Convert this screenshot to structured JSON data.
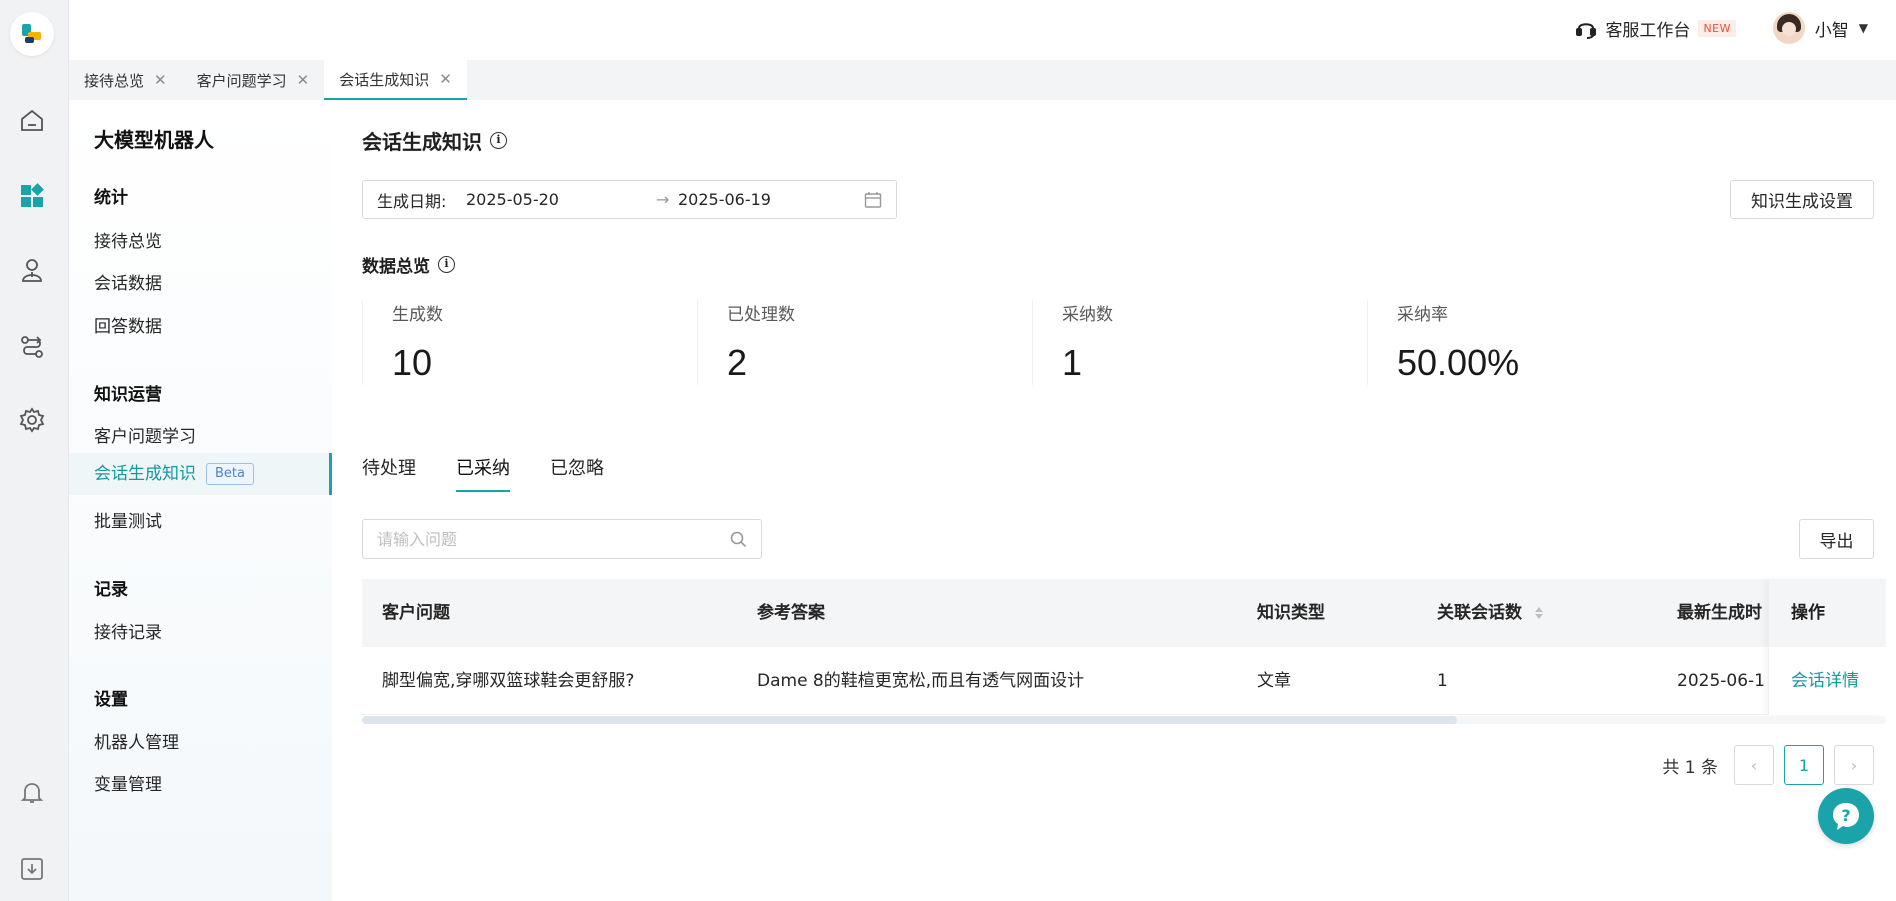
{
  "topbar": {
    "cs_label": "客服工作台",
    "cs_badge": "NEW",
    "user_name": "小智"
  },
  "tabs": [
    {
      "label": "接待总览"
    },
    {
      "label": "客户问题学习"
    },
    {
      "label": "会话生成知识"
    }
  ],
  "sidebar": {
    "title": "大模型机器人",
    "groups": [
      {
        "label": "统计",
        "items": [
          "接待总览",
          "会话数据",
          "回答数据"
        ]
      },
      {
        "label": "知识运营",
        "items": [
          "客户问题学习",
          "会话生成知识",
          "批量测试"
        ]
      },
      {
        "label": "记录",
        "items": [
          "接待记录"
        ]
      },
      {
        "label": "设置",
        "items": [
          "机器人管理",
          "变量管理"
        ]
      }
    ],
    "beta_badge": "Beta"
  },
  "main": {
    "title": "会话生成知识",
    "date": {
      "label": "生成日期:",
      "start": "2025-05-20",
      "arrow": "→",
      "end": "2025-06-19"
    },
    "settings_button": "知识生成设置",
    "overview_title": "数据总览",
    "stats": [
      {
        "label": "生成数",
        "value": "10"
      },
      {
        "label": "已处理数",
        "value": "2"
      },
      {
        "label": "采纳数",
        "value": "1"
      },
      {
        "label": "采纳率",
        "value": "50.00%"
      }
    ],
    "subtabs": [
      "待处理",
      "已采纳",
      "已忽略"
    ],
    "search_placeholder": "请输入问题",
    "export_button": "导出",
    "table": {
      "headers": [
        "客户问题",
        "参考答案",
        "知识类型",
        "关联会话数",
        "最新生成时",
        "操作"
      ],
      "rows": [
        {
          "question": "脚型偏宽,穿哪双篮球鞋会更舒服?",
          "answer": "Dame 8的鞋楦更宽松,而且有透气网面设计",
          "type": "文章",
          "count": "1",
          "time": "2025-06-1",
          "action": "会话详情"
        }
      ]
    },
    "pager": {
      "total": "共 1 条",
      "current": "1"
    }
  },
  "colors": {
    "accent": "#1aa3a8",
    "badge_new": "#e8503a"
  }
}
